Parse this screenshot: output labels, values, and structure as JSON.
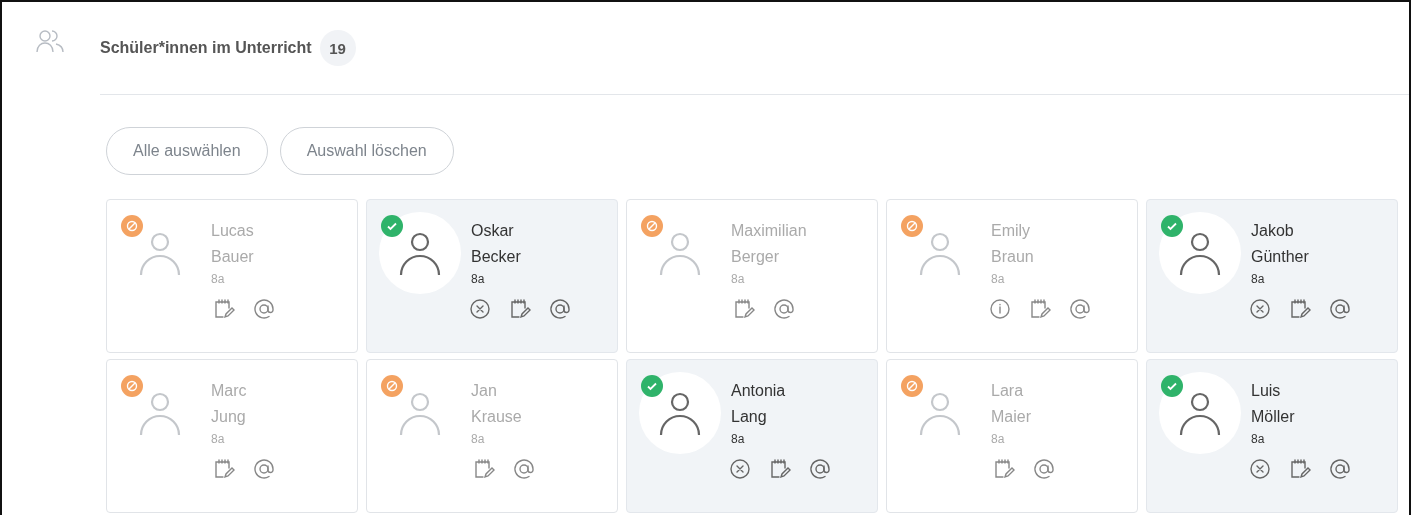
{
  "section": {
    "title": "Schüler*innen im Unterricht",
    "count": "19"
  },
  "buttons": [
    "Alle auswählen",
    "Auswahl löschen"
  ],
  "students": [
    {
      "first": "Lucas",
      "last": "Bauer",
      "class": "8a",
      "present": false,
      "actions": [
        {
          "kind": "notes"
        },
        {
          "kind": "mail"
        }
      ]
    },
    {
      "first": "Oskar",
      "last": "Becker",
      "class": "8a",
      "present": true,
      "actions": [
        {
          "kind": "remove"
        },
        {
          "kind": "notes"
        },
        {
          "kind": "mail"
        }
      ]
    },
    {
      "first": "Maximilian",
      "last": "Berger",
      "class": "8a",
      "present": false,
      "actions": [
        {
          "kind": "notes"
        },
        {
          "kind": "mail"
        }
      ]
    },
    {
      "first": "Emily",
      "last": "Braun",
      "class": "8a",
      "present": false,
      "actions": [
        {
          "kind": "info"
        },
        {
          "kind": "notes"
        },
        {
          "kind": "mail"
        }
      ]
    },
    {
      "first": "Jakob",
      "last": "Günther",
      "class": "8a",
      "present": true,
      "actions": [
        {
          "kind": "remove"
        },
        {
          "kind": "notes"
        },
        {
          "kind": "mail"
        }
      ]
    },
    {
      "first": "Marc",
      "last": "Jung",
      "class": "8a",
      "present": false,
      "actions": [
        {
          "kind": "notes"
        },
        {
          "kind": "mail"
        }
      ]
    },
    {
      "first": "Jan",
      "last": "Krause",
      "class": "8a",
      "present": false,
      "actions": [
        {
          "kind": "notes"
        },
        {
          "kind": "mail"
        }
      ]
    },
    {
      "first": "Antonia",
      "last": "Lang",
      "class": "8a",
      "present": true,
      "actions": [
        {
          "kind": "remove"
        },
        {
          "kind": "notes"
        },
        {
          "kind": "mail"
        }
      ]
    },
    {
      "first": "Lara",
      "last": "Maier",
      "class": "8a",
      "present": false,
      "actions": [
        {
          "kind": "notes"
        },
        {
          "kind": "mail"
        }
      ]
    },
    {
      "first": "Luis",
      "last": "Möller",
      "class": "8a",
      "present": true,
      "actions": [
        {
          "kind": "remove"
        },
        {
          "kind": "notes"
        },
        {
          "kind": "mail"
        }
      ]
    }
  ]
}
